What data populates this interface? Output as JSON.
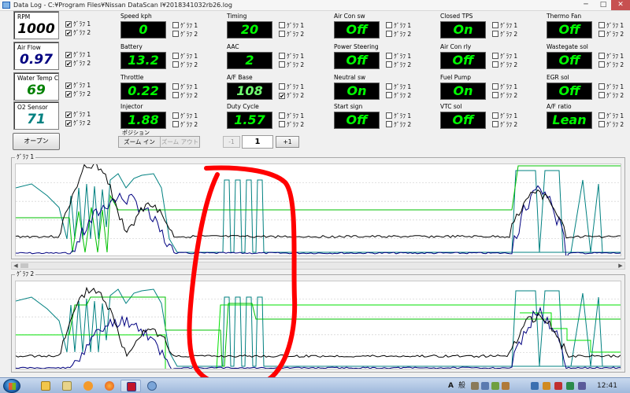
{
  "window": {
    "title": "Data Log - C:¥Program Files¥Nissan DataScan I¥2018341032rb26.log"
  },
  "checkbox_labels": {
    "graph1": "ｸﾞﾗﾌ 1",
    "graph2": "ｸﾞﾗﾌ 2"
  },
  "checked_mark": "✔",
  "sensors": [
    {
      "id": "rpm",
      "label": "RPM",
      "value": "1000",
      "color": "#000000",
      "g1": true,
      "g2": true
    },
    {
      "id": "air-flow",
      "label": "Air Flow",
      "value": "0.97",
      "color": "#000080",
      "g1": true,
      "g2": true
    },
    {
      "id": "water-temp",
      "label": "Water Temp C",
      "value": "69",
      "color": "#008000",
      "g1": true,
      "g2": true
    },
    {
      "id": "o2-sensor",
      "label": "O2 Sensor",
      "value": "71",
      "color": "#008080",
      "g1": true,
      "g2": true
    }
  ],
  "gauges": [
    {
      "id": "speed",
      "label": "Speed kph",
      "value": "0",
      "g1": false,
      "g2": false
    },
    {
      "id": "battery",
      "label": "Battery",
      "value": "13.2",
      "g1": false,
      "g2": false
    },
    {
      "id": "throttle",
      "label": "Throttle",
      "value": "0.22",
      "g1": false,
      "g2": false
    },
    {
      "id": "injector",
      "label": "Injector",
      "value": "1.88",
      "g1": false,
      "g2": false
    },
    {
      "id": "timing",
      "label": "Timing",
      "value": "20",
      "g1": false,
      "g2": false
    },
    {
      "id": "aac",
      "label": "AAC",
      "value": "2",
      "g1": false,
      "g2": false
    },
    {
      "id": "af-base",
      "label": "A/F Base",
      "value": "108",
      "g1": false,
      "g2": true,
      "light": true
    },
    {
      "id": "duty-cycle",
      "label": "Duty Cycle",
      "value": "1.57",
      "g1": false,
      "g2": false
    }
  ],
  "switches": [
    {
      "id": "air-con-sw",
      "label": "Air Con sw",
      "value": "Off",
      "g1": false,
      "g2": false
    },
    {
      "id": "power-steering",
      "label": "Power Steering",
      "value": "Off",
      "g1": false,
      "g2": false
    },
    {
      "id": "neutral-sw",
      "label": "Neutral sw",
      "value": "On",
      "g1": false,
      "g2": false
    },
    {
      "id": "start-sign",
      "label": "Start sign",
      "value": "Off",
      "g1": false,
      "g2": false
    },
    {
      "id": "closed-tps",
      "label": "Closed TPS",
      "value": "On",
      "g1": false,
      "g2": false
    },
    {
      "id": "air-con-rly",
      "label": "Air Con rly",
      "value": "Off",
      "g1": false,
      "g2": false
    },
    {
      "id": "fuel-pump",
      "label": "Fuel Pump",
      "value": "On",
      "g1": false,
      "g2": false
    },
    {
      "id": "vtc-sol",
      "label": "VTC sol",
      "value": "Off",
      "g1": false,
      "g2": false
    },
    {
      "id": "thermo-fan",
      "label": "Thermo Fan",
      "value": "Off",
      "g1": false,
      "g2": false
    },
    {
      "id": "wastegate-sol",
      "label": "Wastegate sol",
      "value": "Off",
      "g1": false,
      "g2": false
    },
    {
      "id": "egr-sol",
      "label": "EGR sol",
      "value": "Off",
      "g1": false,
      "g2": false
    },
    {
      "id": "af-ratio",
      "label": "A/F ratio",
      "value": "Lean",
      "g1": false,
      "g2": false
    }
  ],
  "controls": {
    "open_button": "オープン",
    "position_label": "ポジション",
    "zoom_in": "ズーム イン",
    "zoom_out": "ズーム アウト",
    "prev": "-1",
    "page": "1",
    "next": "+1"
  },
  "graphs": {
    "graph1_title": "ｸﾞﾗﾌ 1",
    "graph2_title": "ｸﾞﾗﾌ 2"
  },
  "taskbar": {
    "apps": [
      "explorer",
      "media-player",
      "firefox",
      "datascan",
      "shockwave"
    ],
    "language": "A",
    "ime": "般",
    "clock": "12:41"
  },
  "colors": {
    "rpm": "#000000",
    "air_flow": "#000080",
    "water_temp": "#00c000",
    "o2_sensor": "#008080",
    "annotation": "#ff0000"
  }
}
